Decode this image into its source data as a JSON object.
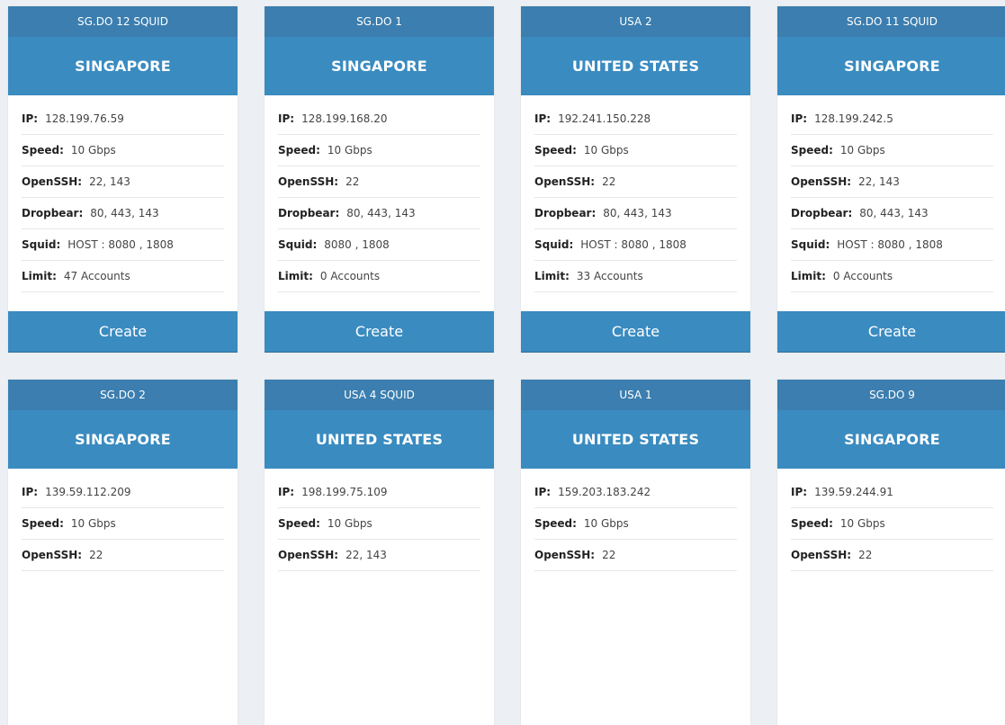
{
  "servers": [
    {
      "name": "SG.DO 12 SQUID",
      "country": "SINGAPORE",
      "ip": "128.199.76.59",
      "speed": "10 Gbps",
      "openssh": "22, 143",
      "dropbear": "80, 443, 143",
      "squid": "HOST : 8080 , 1808",
      "limit": "47 Accounts",
      "button": "Create"
    },
    {
      "name": "SG.DO 1",
      "country": "SINGAPORE",
      "ip": "128.199.168.20",
      "speed": "10 Gbps",
      "openssh": "22",
      "dropbear": "80, 443, 143",
      "squid": "8080 , 1808",
      "limit": "0 Accounts",
      "button": "Create"
    },
    {
      "name": "USA 2",
      "country": "UNITED STATES",
      "ip": "192.241.150.228",
      "speed": "10 Gbps",
      "openssh": "22",
      "dropbear": "80, 443, 143",
      "squid": "HOST : 8080 , 1808",
      "limit": "33 Accounts",
      "button": "Create"
    },
    {
      "name": "SG.DO 11 SQUID",
      "country": "SINGAPORE",
      "ip": "128.199.242.5",
      "speed": "10 Gbps",
      "openssh": "22, 143",
      "dropbear": "80, 443, 143",
      "squid": "HOST : 8080 , 1808",
      "limit": "0 Accounts",
      "button": "Create"
    },
    {
      "name": "SG.DO 2",
      "country": "SINGAPORE",
      "ip": "139.59.112.209",
      "speed": "10 Gbps",
      "openssh": "22"
    },
    {
      "name": "USA 4 SQUID",
      "country": "UNITED STATES",
      "ip": "198.199.75.109",
      "speed": "10 Gbps",
      "openssh": "22, 143"
    },
    {
      "name": "USA 1",
      "country": "UNITED STATES",
      "ip": "159.203.183.242",
      "speed": "10 Gbps",
      "openssh": "22"
    },
    {
      "name": "SG.DO 9",
      "country": "SINGAPORE",
      "ip": "139.59.244.91",
      "speed": "10 Gbps",
      "openssh": "22"
    }
  ],
  "labels": {
    "ip": "IP:",
    "speed": "Speed:",
    "openssh": "OpenSSH:",
    "dropbear": "Dropbear:",
    "squid": "Squid:",
    "limit": "Limit:"
  },
  "colors": {
    "header": "#3b7eaf",
    "country_band": "#3a8bc0",
    "button": "#3a8bc0",
    "page_background": "#eceff3"
  }
}
